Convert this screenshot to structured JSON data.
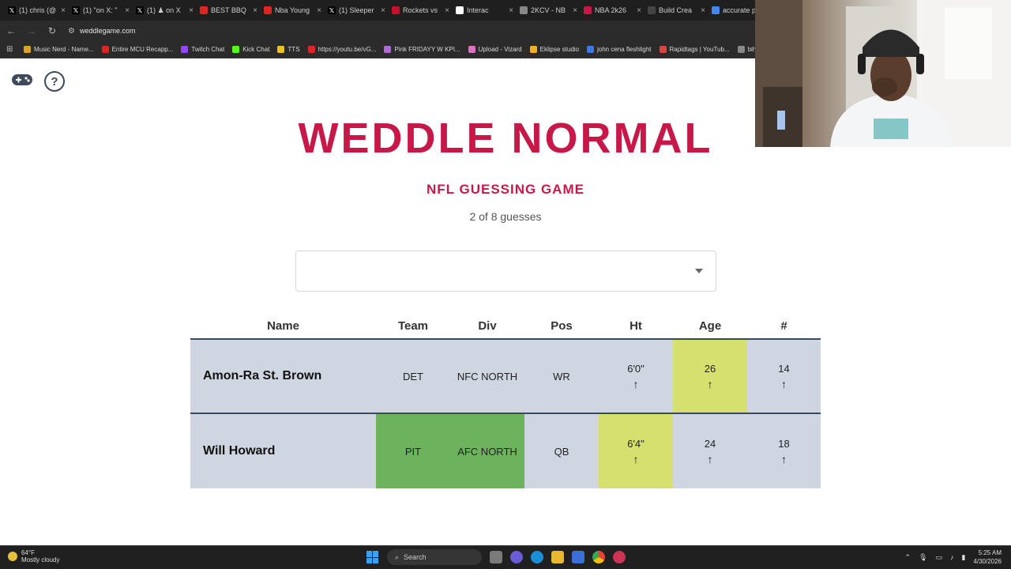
{
  "browser": {
    "tabs": [
      {
        "title": "(1) chris (@",
        "favicon": "x-icon",
        "color": "#000000"
      },
      {
        "title": "(1) \"on X: \"",
        "favicon": "x-icon",
        "color": "#000000"
      },
      {
        "title": "(1) ♟ on X",
        "favicon": "x-icon",
        "color": "#000000"
      },
      {
        "title": "BEST BBQ",
        "favicon": "youtube-icon",
        "color": "#e02424"
      },
      {
        "title": "Nba Young",
        "favicon": "youtube-icon",
        "color": "#e02424"
      },
      {
        "title": "(1) Sleeper",
        "favicon": "x-icon",
        "color": "#000000"
      },
      {
        "title": "Rockets vs",
        "favicon": "generic-icon",
        "color": "#c8102e"
      },
      {
        "title": "Interac",
        "favicon": "generic-icon",
        "color": "#ffffff"
      },
      {
        "title": "2KCV - NB",
        "favicon": "generic-icon",
        "color": "#888888"
      },
      {
        "title": "NBA 2k26",
        "favicon": "generic-icon",
        "color": "#c8184a"
      },
      {
        "title": "Build Crea",
        "favicon": "generic-icon",
        "color": "#444444"
      },
      {
        "title": "accurate p",
        "favicon": "google-icon",
        "color": "#4285f4"
      }
    ],
    "url": "weddlegame.com",
    "bookmarks": [
      {
        "label": "Music Nerd - Name...",
        "color": "#e0a030"
      },
      {
        "label": "Entire MCU Recapp...",
        "color": "#e02424"
      },
      {
        "label": "Twitch Chat",
        "color": "#9146ff"
      },
      {
        "label": "Kick Chat",
        "color": "#53fc18"
      },
      {
        "label": "TTS",
        "color": "#f0c020"
      },
      {
        "label": "https://youtu.be/vG...",
        "color": "#e02424"
      },
      {
        "label": "Pink FRIDAYY W KPI...",
        "color": "#b06ad9"
      },
      {
        "label": "Upload - Vizard",
        "color": "#e070c0"
      },
      {
        "label": "Eklipse studio",
        "color": "#f0b020"
      },
      {
        "label": "john cena fleshlight",
        "color": "#3a7be0"
      },
      {
        "label": "Rapidtags | YouTub...",
        "color": "#e04040"
      },
      {
        "label": "bih links",
        "color": "#888888"
      }
    ]
  },
  "game": {
    "title": "WEDDLE NORMAL",
    "subtitle": "NFL GUESSING GAME",
    "guess_count": "2 of 8 guesses",
    "search_placeholder": "",
    "columns": [
      "Name",
      "Team",
      "Div",
      "Pos",
      "Ht",
      "Age",
      "#"
    ],
    "rows": [
      {
        "name": "Amon-Ra St. Brown",
        "team": {
          "value": "DET",
          "status": "none"
        },
        "div": {
          "value": "NFC NORTH",
          "status": "none"
        },
        "pos": {
          "value": "WR",
          "status": "none"
        },
        "ht": {
          "value": "6'0\"",
          "arrow": "↑",
          "status": "none"
        },
        "age": {
          "value": "26",
          "arrow": "↑",
          "status": "close"
        },
        "num": {
          "value": "14",
          "arrow": "↑",
          "status": "none"
        }
      },
      {
        "name": "Will Howard",
        "team": {
          "value": "PIT",
          "status": "correct"
        },
        "div": {
          "value": "AFC NORTH",
          "status": "correct"
        },
        "pos": {
          "value": "QB",
          "status": "none"
        },
        "ht": {
          "value": "6'4\"",
          "arrow": "↑",
          "status": "close"
        },
        "age": {
          "value": "24",
          "arrow": "↑",
          "status": "none"
        },
        "num": {
          "value": "18",
          "arrow": "↑",
          "status": "none"
        }
      }
    ],
    "colors": {
      "accent": "#c8184a",
      "correct": "#6db35e",
      "close": "#d5e06e",
      "row_bg": "#cfd6e1"
    }
  },
  "taskbar": {
    "weather_temp": "64°F",
    "weather_desc": "Mostly cloudy",
    "search_label": "Search",
    "time": "5:25 AM",
    "date": "4/30/2026"
  }
}
